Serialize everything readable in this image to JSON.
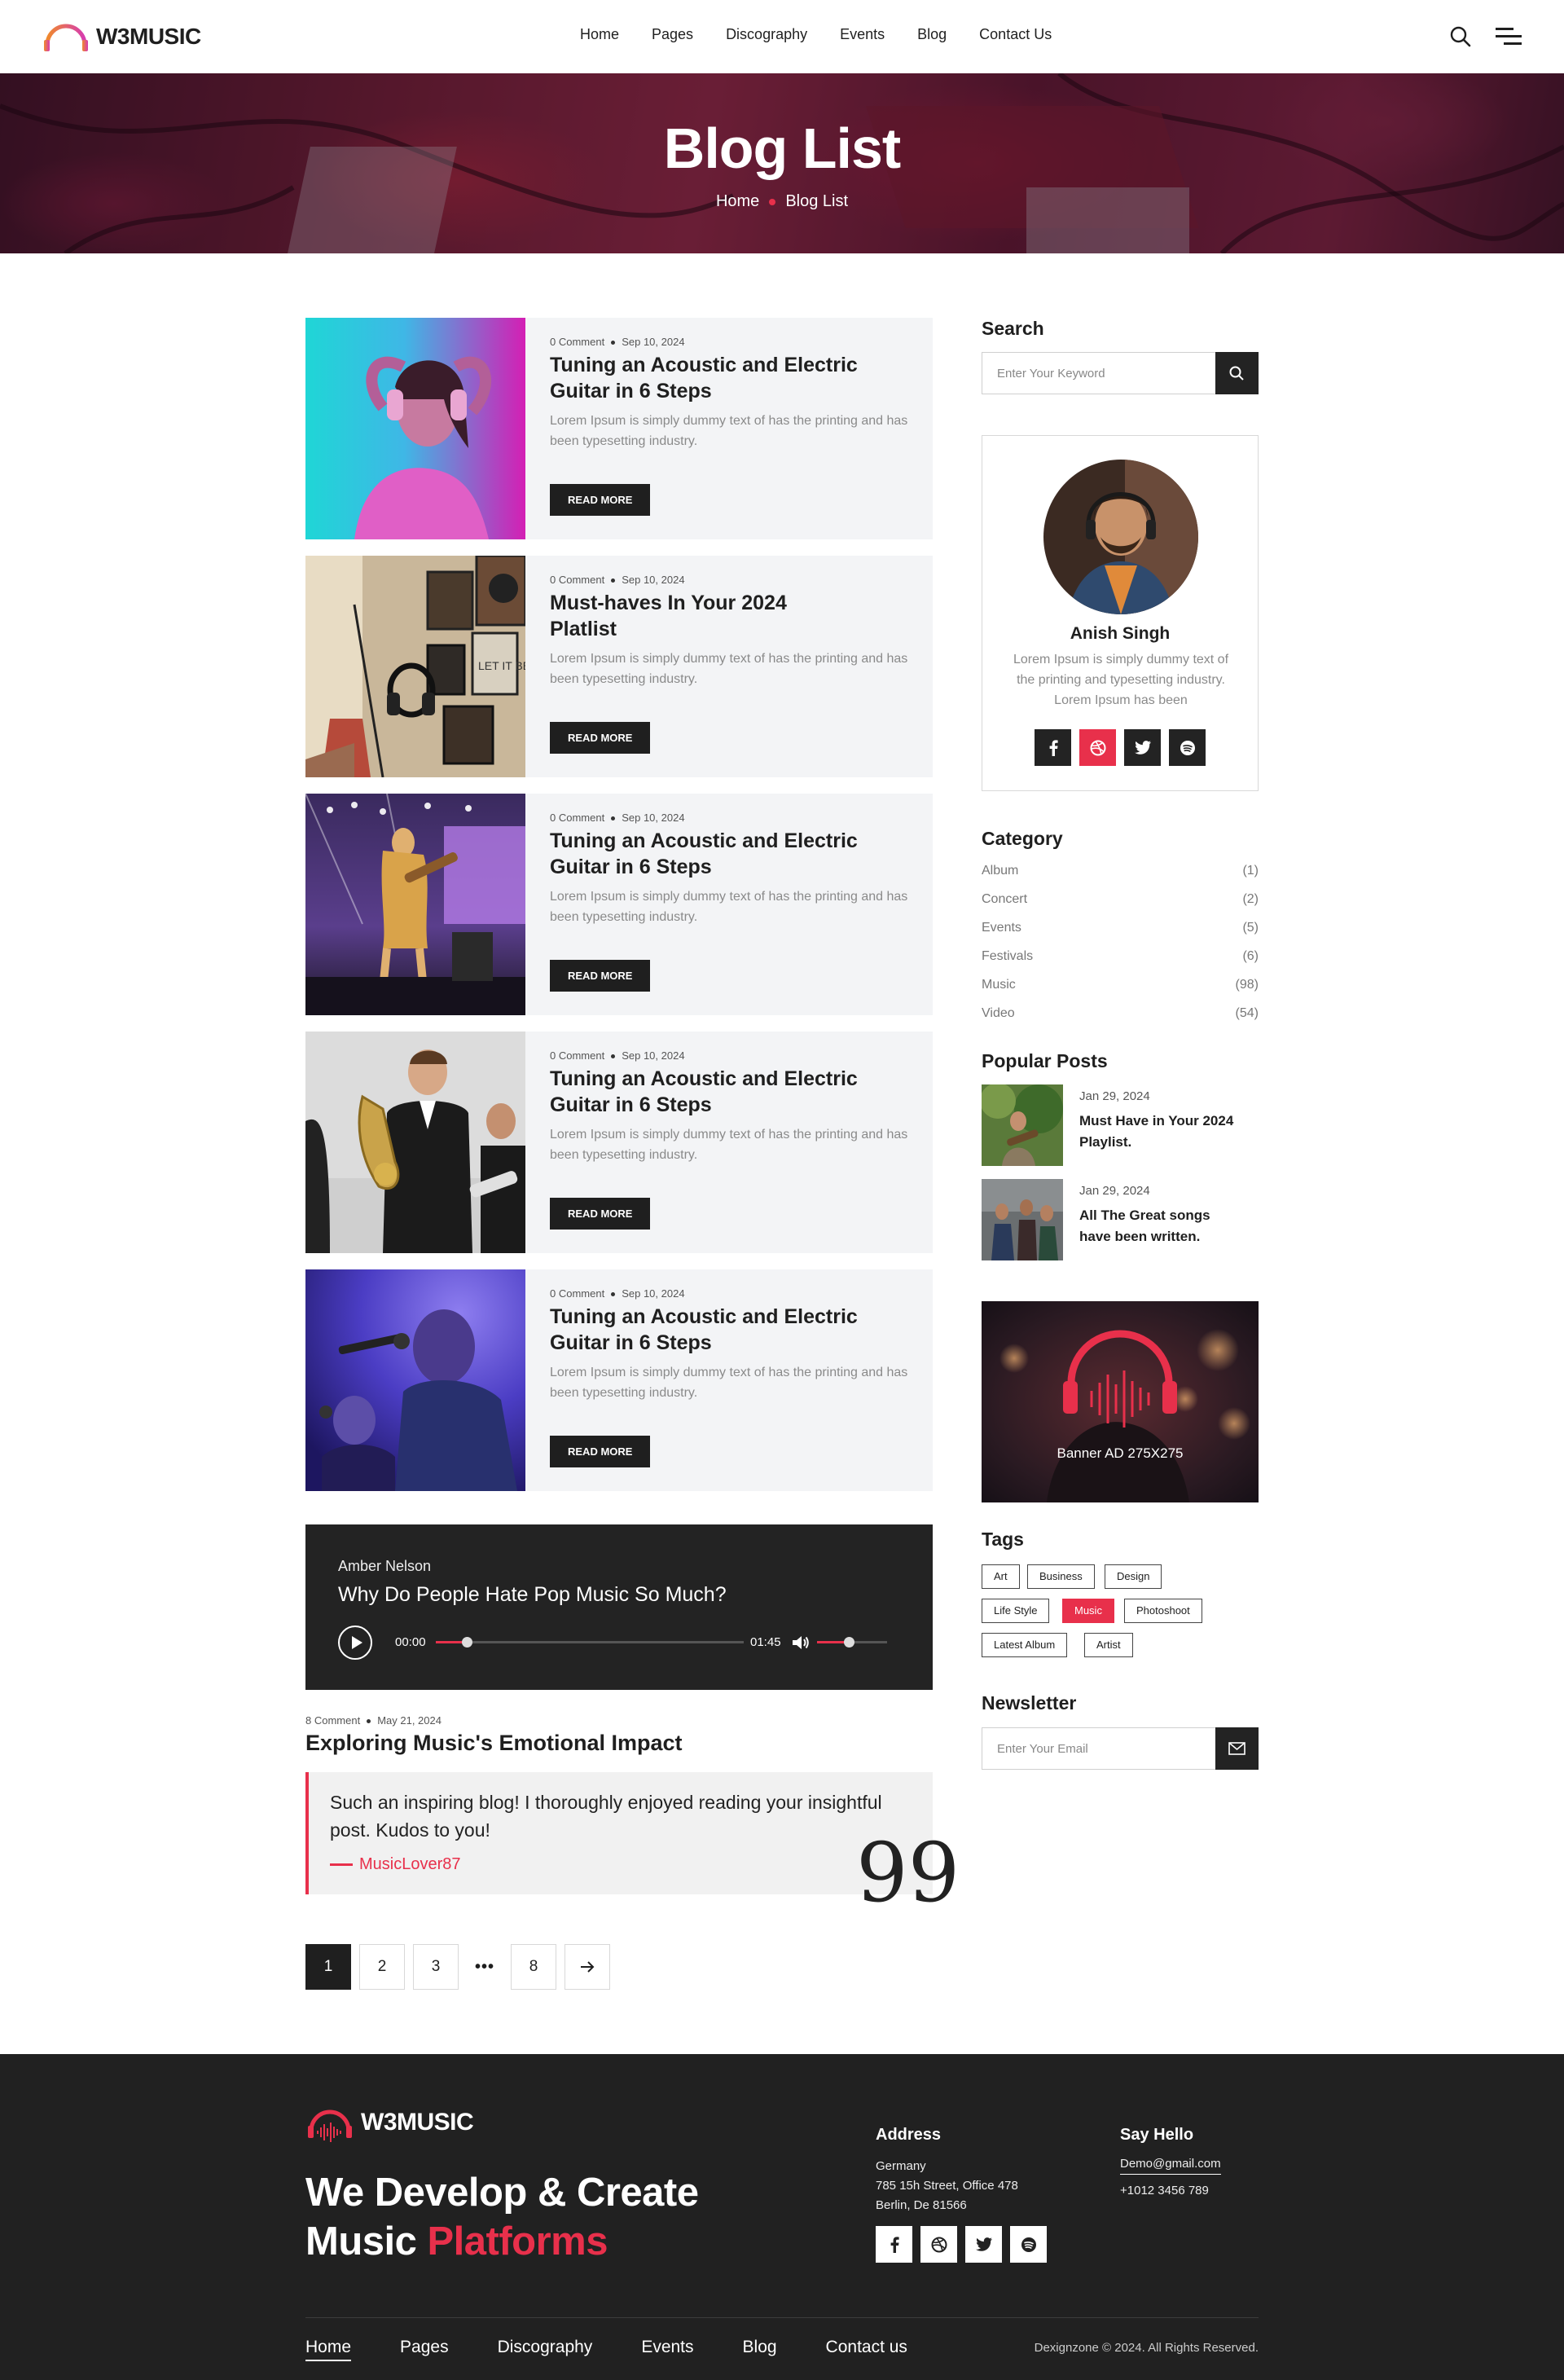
{
  "header": {
    "logo": "W3MUSIC",
    "nav": [
      "Home",
      "Pages",
      "Discography",
      "Events",
      "Blog",
      "Contact Us"
    ]
  },
  "hero": {
    "title": "Blog List",
    "breadcrumb": [
      "Home",
      "Blog List"
    ]
  },
  "posts": [
    {
      "comments": "0 Comment",
      "date": "Sep 10, 2024",
      "title": "Tuning an Acoustic and Electric Guitar in 6 Steps",
      "excerpt": "Lorem Ipsum is simply dummy text of has the printing and has been typesetting industry.",
      "button": "READ MORE"
    },
    {
      "comments": "0 Comment",
      "date": "Sep 10, 2024",
      "title": "Must-haves In Your 2024 Platlist",
      "excerpt": "Lorem Ipsum is simply dummy text of has the printing and has been typesetting industry.",
      "button": "READ MORE"
    },
    {
      "comments": "0 Comment",
      "date": "Sep 10, 2024",
      "title": "Tuning an Acoustic and Electric Guitar in 6 Steps",
      "excerpt": "Lorem Ipsum is simply dummy text of has the printing and has been typesetting industry.",
      "button": "READ MORE"
    },
    {
      "comments": "0 Comment",
      "date": "Sep 10, 2024",
      "title": "Tuning an Acoustic and Electric Guitar in 6 Steps",
      "excerpt": "Lorem Ipsum is simply dummy text of has the printing and has been typesetting industry.",
      "button": "READ MORE"
    },
    {
      "comments": "0 Comment",
      "date": "Sep 10, 2024",
      "title": "Tuning an Acoustic and Electric Guitar in 6 Steps",
      "excerpt": "Lorem Ipsum is simply dummy text of has the printing and has been typesetting industry.",
      "button": "READ MORE"
    }
  ],
  "player": {
    "artist": "Amber Nelson",
    "title": "Why Do People Hate Pop Music So Much?",
    "current_time": "00:00",
    "duration": "01:45",
    "progress": 0.1,
    "volume": 0.45
  },
  "quote_post": {
    "comments": "8 Comment",
    "date": "May 21, 2024",
    "title": "Exploring Music's Emotional Impact",
    "quote": "Such an inspiring blog! I thoroughly enjoyed reading your insightful post. Kudos to you!",
    "author": "MusicLover87",
    "quote_mark": "99"
  },
  "pagination": {
    "pages": [
      "1",
      "2",
      "3",
      "8"
    ],
    "ellipsis": "•••",
    "current": "1",
    "next_icon": "arrow-right-icon"
  },
  "sidebar": {
    "search": {
      "heading": "Search",
      "placeholder": "Enter Your Keyword"
    },
    "profile": {
      "name": "Anish Singh",
      "bio": "Lorem Ipsum is simply dummy text of the printing and typesetting industry. Lorem Ipsum has been",
      "social": [
        "facebook-icon",
        "dribbble-icon",
        "twitter-icon",
        "spotify-icon"
      ]
    },
    "category": {
      "heading": "Category",
      "items": [
        {
          "name": "Album",
          "count": "(1)"
        },
        {
          "name": "Concert",
          "count": "(2)"
        },
        {
          "name": "Events",
          "count": "(5)"
        },
        {
          "name": "Festivals",
          "count": "(6)"
        },
        {
          "name": "Music",
          "count": "(98)"
        },
        {
          "name": "Video",
          "count": "(54)"
        }
      ]
    },
    "popular": {
      "heading": "Popular Posts",
      "items": [
        {
          "date": "Jan 29, 2024",
          "title": "Must Have in  Your 2024 Playlist."
        },
        {
          "date": "Jan 29, 2024",
          "title": "All The Great songs have been written."
        }
      ]
    },
    "banner": {
      "text": "Banner AD 275X275"
    },
    "tags": {
      "heading": "Tags",
      "items": [
        "Art",
        "Business",
        "Design",
        "Life Style",
        "Music",
        "Photoshoot",
        "Latest Album",
        "Artist"
      ],
      "active": "Music"
    },
    "newsletter": {
      "heading": "Newsletter",
      "placeholder": "Enter Your Email"
    }
  },
  "footer": {
    "logo": "W3MUSIC",
    "tagline_line1": "We Develop & Create",
    "tagline_line2_a": "Music ",
    "tagline_line2_b": "Platforms",
    "address": {
      "heading": "Address",
      "line1": "Germany",
      "line2": "785 15h Street, Office 478",
      "line3": "Berlin, De 81566"
    },
    "contact": {
      "heading": "Say Hello",
      "email": "Demo@gmail.com",
      "phone": "+1012 3456 789"
    },
    "social": [
      "facebook-icon",
      "dribbble-icon",
      "twitter-icon",
      "spotify-icon"
    ],
    "nav": [
      "Home",
      "Pages",
      "Discography",
      "Events",
      "Blog",
      "Contact us"
    ],
    "copyright": "Dexignzone © 2024. All Rights Reserved."
  },
  "colors": {
    "accent": "#e8304b",
    "dark": "#212121",
    "card_bg": "#f3f4f6"
  }
}
